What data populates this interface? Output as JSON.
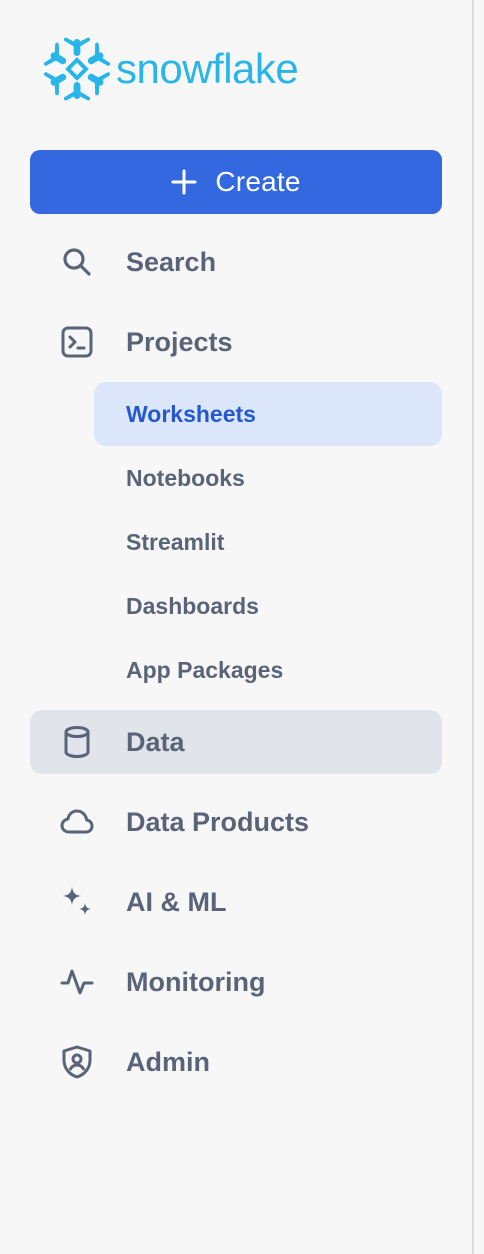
{
  "brand": {
    "name": "snowflake",
    "logo_icon": "snowflake-logo-icon",
    "color": "#29b5e8"
  },
  "create_button": {
    "label": "Create",
    "icon": "plus-icon",
    "color": "#3368e0"
  },
  "nav": {
    "search": {
      "label": "Search",
      "icon": "search-icon"
    },
    "projects": {
      "label": "Projects",
      "icon": "terminal-icon",
      "children": [
        {
          "label": "Worksheets",
          "selected": true
        },
        {
          "label": "Notebooks"
        },
        {
          "label": "Streamlit"
        },
        {
          "label": "Dashboards"
        },
        {
          "label": "App Packages"
        }
      ]
    },
    "data": {
      "label": "Data",
      "icon": "database-icon",
      "highlighted": true
    },
    "data_products": {
      "label": "Data Products",
      "icon": "cloud-icon"
    },
    "ai_ml": {
      "label": "AI & ML",
      "icon": "sparkle-icon"
    },
    "monitoring": {
      "label": "Monitoring",
      "icon": "activity-icon"
    },
    "admin": {
      "label": "Admin",
      "icon": "shield-user-icon"
    }
  },
  "colors": {
    "selected_text": "#2458d3",
    "selected_bg": "#dbe6fb",
    "highlight_bg": "#e1e4ea",
    "nav_text": "#5a6478"
  }
}
